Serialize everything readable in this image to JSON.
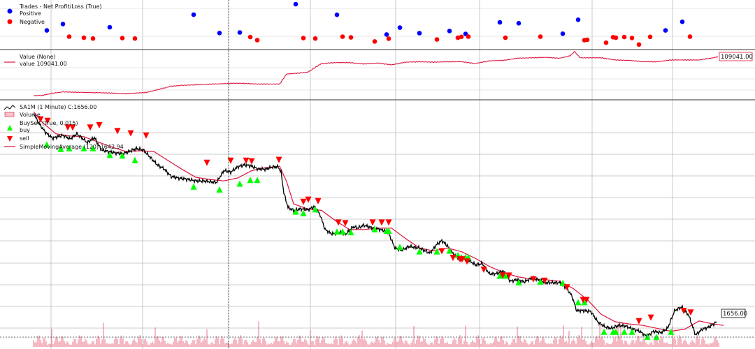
{
  "chart_data": [
    {
      "type": "scatter",
      "panel": "trades",
      "legend_title": "Trades - Net Profit/Loss (True)",
      "series": [
        {
          "name": "Positive",
          "color": "#0000ff",
          "x": [
            67,
            90,
            157,
            277,
            314,
            343,
            423,
            482,
            553,
            572,
            600,
            643,
            666,
            715,
            742,
            805,
            827,
            952,
            976
          ],
          "y": [
            3200,
            6700,
            4900,
            11800,
            1800,
            2100,
            17500,
            11700,
            1000,
            4700,
            1700,
            2900,
            1300,
            7600,
            7100,
            1400,
            9000,
            3200,
            7900
          ]
        },
        {
          "name": "Negative",
          "color": "#ff0000",
          "x": [
            99,
            120,
            133,
            175,
            193,
            358,
            368,
            434,
            451,
            490,
            502,
            536,
            556,
            625,
            655,
            660,
            670,
            723,
            773,
            836,
            840,
            867,
            877,
            881,
            893,
            904,
            914,
            930,
            987
          ],
          "y": [
            -200,
            -800,
            -1200,
            -1000,
            -1200,
            -400,
            -2100,
            -1000,
            -1200,
            -200,
            -600,
            -2800,
            -1300,
            -1700,
            -800,
            -300,
            -200,
            -800,
            -200,
            -2100,
            -1900,
            -3500,
            -500,
            -800,
            -400,
            -900,
            -4500,
            -300,
            -200
          ]
        }
      ]
    },
    {
      "type": "line",
      "panel": "value",
      "legend_title": "Value (None)",
      "series_label": "value 109041.00",
      "last_value_tag": "109041.00",
      "color": "#dc143c",
      "x": [
        48,
        60,
        75,
        90,
        120,
        150,
        180,
        210,
        230,
        245,
        260,
        290,
        320,
        340,
        370,
        400,
        410,
        420,
        440,
        460,
        480,
        500,
        520,
        540,
        560,
        580,
        600,
        620,
        640,
        660,
        680,
        700,
        720,
        740,
        760,
        780,
        800,
        815,
        822,
        830,
        860,
        880,
        900,
        920,
        940,
        960,
        980,
        1000,
        1020,
        1027
      ],
      "y": [
        100150,
        100200,
        100700,
        101000,
        100900,
        100800,
        100600,
        100900,
        101700,
        102300,
        102500,
        102700,
        102900,
        103000,
        102800,
        102800,
        105100,
        105200,
        105500,
        107500,
        107700,
        107700,
        107400,
        107600,
        107200,
        107800,
        107900,
        107800,
        107900,
        107900,
        107500,
        108100,
        108200,
        108700,
        108800,
        108900,
        108700,
        109200,
        110200,
        108800,
        108800,
        108300,
        108200,
        107900,
        107900,
        108300,
        108300,
        108300,
        108800,
        109041
      ]
    },
    {
      "type": "line",
      "panel": "price",
      "legend": [
        "SA1M (1 Minute) C:1656.00",
        "Volume",
        "BuySell (True, 0.015)",
        "buy",
        "sell",
        "SimpleMovingAverage (120) 1642.94"
      ],
      "last_value_tag": "1656.00",
      "price_series": {
        "name": "SA1M (1 Minute) C:1656.00",
        "color": "#000000",
        "x": [
          48,
          55,
          65,
          75,
          90,
          100,
          110,
          125,
          135,
          145,
          160,
          175,
          185,
          195,
          205,
          215,
          225,
          235,
          245,
          255,
          270,
          280,
          290,
          300,
          310,
          320,
          330,
          340,
          350,
          360,
          370,
          380,
          390,
          398,
          402,
          406,
          412,
          420,
          430,
          440,
          450,
          458,
          465,
          475,
          485,
          495,
          505,
          512,
          520,
          530,
          540,
          555,
          565,
          575,
          585,
          600,
          615,
          625,
          632,
          640,
          650,
          660,
          670,
          680,
          690,
          700,
          710,
          720,
          730,
          740,
          750,
          760,
          770,
          780,
          790,
          800,
          810,
          818,
          825,
          835,
          845,
          855,
          865,
          875,
          885,
          895,
          905,
          915,
          925,
          935,
          945,
          955,
          965,
          975,
          985,
          995,
          1005,
          1015,
          1025
        ],
        "y": [
          1838,
          1825,
          1812,
          1804,
          1808,
          1803,
          1810,
          1798,
          1805,
          1788,
          1785,
          1783,
          1786,
          1790,
          1788,
          1778,
          1768,
          1762,
          1752,
          1750,
          1748,
          1746,
          1746,
          1745,
          1744,
          1760,
          1758,
          1765,
          1768,
          1766,
          1762,
          1762,
          1765,
          1765,
          1758,
          1730,
          1710,
          1706,
          1708,
          1707,
          1711,
          1700,
          1680,
          1674,
          1676,
          1674,
          1684,
          1682,
          1686,
          1683,
          1681,
          1677,
          1655,
          1652,
          1657,
          1655,
          1648,
          1660,
          1665,
          1658,
          1645,
          1640,
          1639,
          1632,
          1634,
          1620,
          1620,
          1624,
          1610,
          1612,
          1609,
          1614,
          1612,
          1608,
          1608,
          1608,
          1601,
          1590,
          1570,
          1570,
          1569,
          1555,
          1548,
          1546,
          1550,
          1549,
          1545,
          1542,
          1535,
          1542,
          1540,
          1546,
          1570,
          1575,
          1564,
          1537,
          1545,
          1548,
          1555
        ]
      },
      "sma_series": {
        "name": "SimpleMovingAverage (120) 1642.94",
        "color": "#dc143c",
        "x": [
          48,
          60,
          80,
          100,
          120,
          140,
          160,
          180,
          200,
          220,
          240,
          260,
          280,
          300,
          320,
          340,
          360,
          380,
          400,
          410,
          420,
          440,
          460,
          480,
          500,
          520,
          540,
          560,
          580,
          600,
          620,
          640,
          660,
          680,
          700,
          720,
          740,
          760,
          780,
          800,
          820,
          840,
          860,
          880,
          900,
          920,
          940,
          960,
          980,
          1000,
          1020,
          1035
        ],
        "y": [
          1840,
          1826,
          1810,
          1807,
          1806,
          1799,
          1792,
          1786,
          1787,
          1786,
          1774,
          1762,
          1751,
          1748,
          1746,
          1750,
          1760,
          1764,
          1766,
          1745,
          1715,
          1708,
          1706,
          1692,
          1680,
          1680,
          1682,
          1682,
          1668,
          1655,
          1651,
          1655,
          1650,
          1641,
          1630,
          1622,
          1616,
          1613,
          1612,
          1610,
          1600,
          1585,
          1565,
          1555,
          1552,
          1550,
          1546,
          1542,
          1545,
          1556,
          1552,
          1550
        ]
      },
      "markers": {
        "buy": {
          "name": "buy",
          "color": "#00ff00",
          "x": [
            67,
            87,
            99,
            120,
            133,
            157,
            175,
            193,
            277,
            314,
            343,
            358,
            368,
            423,
            434,
            451,
            482,
            490,
            502,
            536,
            553,
            556,
            572,
            600,
            625,
            643,
            655,
            660,
            666,
            670,
            715,
            723,
            742,
            773,
            805,
            827,
            836,
            864,
            877,
            881,
            893,
            904,
            926,
            939,
            960
          ],
          "y": [
            1795,
            1789,
            1790,
            1790,
            1790,
            1781,
            1780,
            1774,
            1738,
            1734,
            1742,
            1747,
            1747,
            1704,
            1702,
            1707,
            1677,
            1677,
            1676,
            1680,
            1678,
            1678,
            1656,
            1650,
            1650,
            1651,
            1645,
            1642,
            1642,
            1642,
            1617,
            1617,
            1608,
            1609,
            1607,
            1581,
            1581,
            1541,
            1541,
            1541,
            1541,
            1541,
            1534,
            1534,
            1541
          ]
        },
        "sell": {
          "name": "sell",
          "color": "#ff0000",
          "x": [
            58,
            68,
            97,
            104,
            129,
            142,
            168,
            187,
            209,
            296,
            330,
            352,
            360,
            399,
            434,
            441,
            455,
            484,
            494,
            533,
            546,
            556,
            632,
            648,
            658,
            661,
            668,
            692,
            719,
            728,
            763,
            779,
            811,
            834,
            839,
            914,
            931,
            978,
            988
          ],
          "y": [
            1830,
            1828,
            1819,
            1819,
            1819,
            1822,
            1814,
            1811,
            1808,
            1771,
            1774,
            1774,
            1773,
            1775,
            1718,
            1721,
            1719,
            1690,
            1689,
            1690,
            1690,
            1690,
            1651,
            1642,
            1640,
            1640,
            1637,
            1626,
            1618,
            1618,
            1613,
            1611,
            1602,
            1585,
            1585,
            1556,
            1561,
            1570,
            1568
          ]
        }
      },
      "volume": {
        "name": "Volume",
        "color": "#dc143c"
      }
    }
  ]
}
